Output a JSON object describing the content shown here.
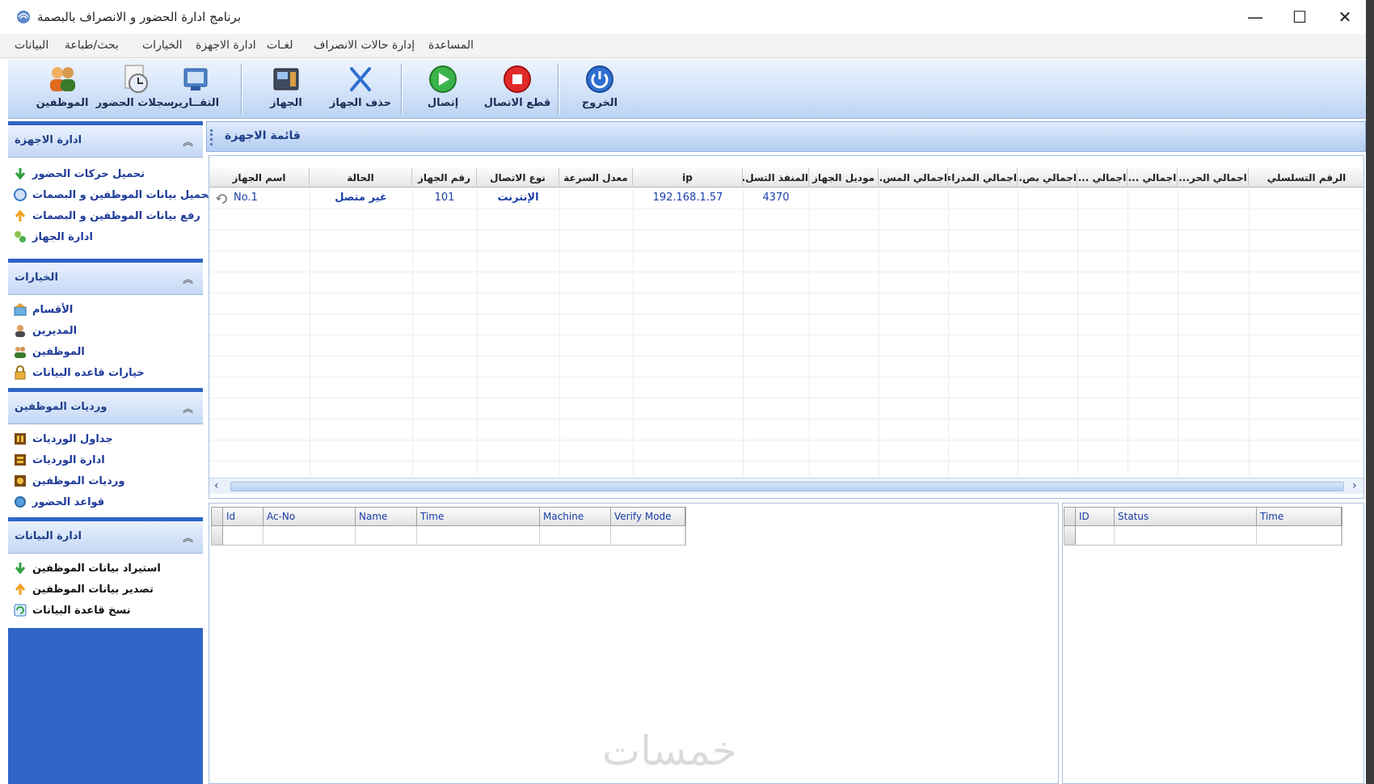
{
  "window": {
    "title": "برنامج ادارة الحضور و الانصراف بالبصمة",
    "minimize": "—",
    "maximize": "☐",
    "close": "✕"
  },
  "menu": [
    "البيانات",
    "بحث/طباعة",
    "الخيارات",
    "ادارة الاجهزة",
    "لغـات",
    "إدارة حالات الانصراف",
    "المساعدة"
  ],
  "toolbar": {
    "employees": "الموظفين",
    "attendance_records": "سجلات الحضور",
    "reports": "التقــارير",
    "device": "الجهاز",
    "delete_device": "حذف الجهاز",
    "connect": "إتصال",
    "disconnect": "قطع الاتصال",
    "exit": "الخروج"
  },
  "sidebar": {
    "device_mgmt": {
      "title": "ادارة الاجهزة",
      "items": [
        "تحميل حركات الحضور",
        "تحميل بيانات الموظفين و البصمات",
        "رفع بيانات الموظفين و البصمات",
        "ادارة الجهاز"
      ]
    },
    "options": {
      "title": "الخيارات",
      "items": [
        "الأقسام",
        "المديرين",
        "الموظفين",
        "خيارات قاعده البيانات"
      ]
    },
    "shifts": {
      "title": "ورديات الموظفين",
      "items": [
        "جداول الورديات",
        "ادارة الورديات",
        "ورديات الموظفين",
        "قواعد الحضور"
      ]
    },
    "data_mgmt": {
      "title": "ادارة البيانات",
      "items": [
        "استيراد بيانات الموظفين",
        "تصدير بيانات الموظفين",
        "نسخ قاعدة البيانات"
      ]
    },
    "collapse_glyph": "︽"
  },
  "main": {
    "title": "قائمة الاجهزة",
    "columns": [
      "اسم الجهاز",
      "الحالة",
      "رقم الجهاز",
      "نوع الاتصال",
      "معدل السرعة",
      "ip",
      "المنفذ التسل...",
      "موديل الجهاز",
      "اجمالي المس...",
      "اجمالي المدراء...",
      "اجمالي بص...",
      "اجمالي ...",
      "اجمالي ...",
      "اجمالي الحر...",
      "الرقم التسلسلي"
    ],
    "rows": [
      {
        "name": "No.1",
        "status": "غير متصل",
        "device_no": "101",
        "conn_type": "الإنترنت",
        "speed": "",
        "ip": "192.168.1.57",
        "port": "4370"
      }
    ],
    "scroll_left": "‹",
    "scroll_right": "›"
  },
  "log_table": {
    "columns": [
      "Id",
      "Ac-No",
      "Name",
      "Time",
      "Machine",
      "Verify Mode"
    ]
  },
  "status_table": {
    "columns": [
      "ID",
      "Status",
      "Time"
    ]
  },
  "watermark": "خمسات",
  "colors": {
    "sidebar_bg": "#2f64c8",
    "accent_text": "#1e3a9a",
    "toolbar_gradient_top": "#eef4fd",
    "toolbar_gradient_bottom": "#bcd3f3"
  }
}
